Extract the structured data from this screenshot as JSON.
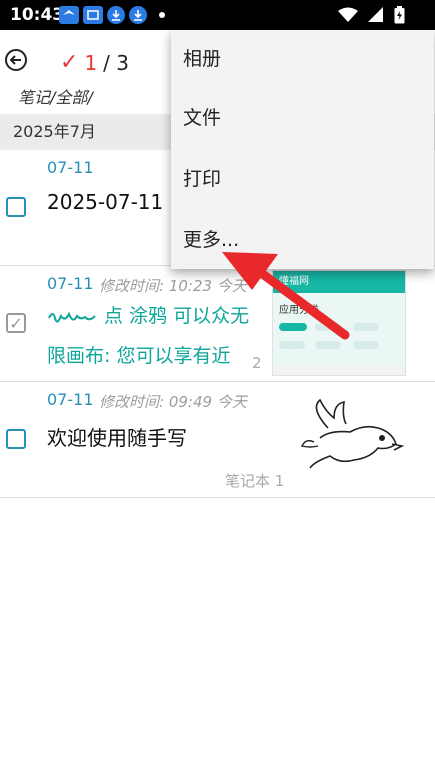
{
  "status_bar": {
    "time": "10:43"
  },
  "toolbar": {
    "selected_count": "1",
    "separator_total": "/ 3",
    "path": "笔记/全部/"
  },
  "month_header": "2025年7月",
  "notes": [
    {
      "date": "07-11",
      "title": "2025-07-11"
    },
    {
      "date": "07-11",
      "modified": "修改时间: 10:23 今天",
      "line1": "点 涂鸦 可以众无",
      "line2": "限画布: 您可以享有近",
      "index": "2"
    },
    {
      "date": "07-11",
      "modified": "修改时间: 09:49 今天",
      "title": "欢迎使用随手写",
      "notebook": "笔记本 1"
    }
  ],
  "menu": {
    "items": [
      "相册",
      "文件",
      "打印",
      "更多..."
    ]
  },
  "thumbnail": {
    "header": "懂福网",
    "subtitle": "应用分类"
  },
  "colors": {
    "accent": "#2a8fb8",
    "teal": "#0ea59a",
    "check_red": "#e53935",
    "annotation_red": "#e8282b"
  }
}
